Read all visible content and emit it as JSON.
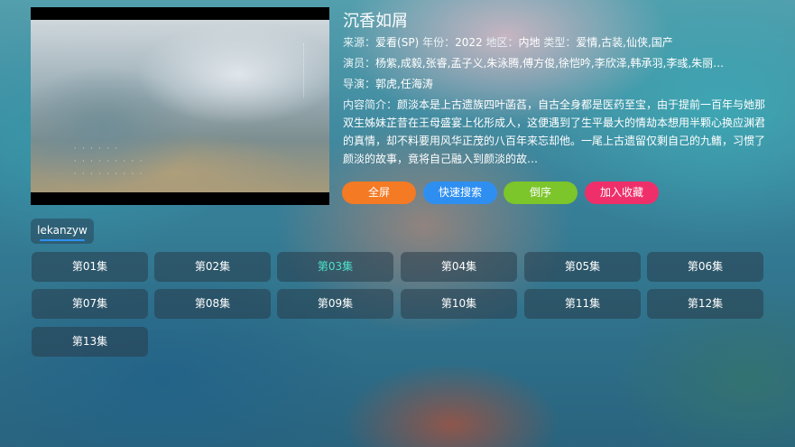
{
  "video": {
    "title": "沉香如屑",
    "source_label": "来源：",
    "source": "爱看(SP)",
    "year_label": "年份：",
    "year": "2022",
    "region_label": "地区：",
    "region": "内地",
    "type_label": "类型：",
    "type": "爱情,古装,仙侠,国产",
    "cast_label": "演员：",
    "cast": "杨紫,成毅,张睿,孟子义,朱泳腾,傅方俊,徐恺吟,李欣泽,韩承羽,李彧,朱丽…",
    "director_label": "导演：",
    "director": "郭虎,任海涛",
    "summary_label": "内容简介：",
    "summary": "颜淡本是上古遗族四叶菡萏，自古全身都是医药至宝，由于提前一百年与她那双生姊妹芷昔在王母盛宴上化形成人，这便遇到了生平最大的情劫本想用半颗心换应渊君的真情，却不料要用风华正茂的八百年来忘却他。一尾上古遗留仅剩自己的九鳍，习惯了颜淡的故事，竟将自己融入到颜淡的故…"
  },
  "actions": {
    "fullscreen": "全屏",
    "quick_search": "快速搜索",
    "reverse": "倒序",
    "favorite": "加入收藏"
  },
  "colors": {
    "fullscreen": "#f47a24",
    "quick_search": "#2f8ff0",
    "reverse": "#7cc52a",
    "favorite": "#ef2f6a",
    "active_episode": "#4fe0c6"
  },
  "source_tab": "lekanzyw",
  "episodes": [
    "第01集",
    "第02集",
    "第03集",
    "第04集",
    "第05集",
    "第06集",
    "第07集",
    "第08集",
    "第09集",
    "第10集",
    "第11集",
    "第12集",
    "第13集"
  ],
  "active_episode": "第03集"
}
